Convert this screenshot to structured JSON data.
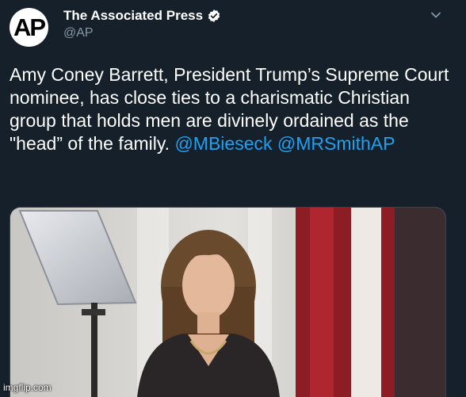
{
  "account": {
    "avatar_text": "AP",
    "display_name": "The Associated Press",
    "handle": "@AP",
    "verified_icon": "verified-badge-icon",
    "menu_icon": "chevron-down-icon"
  },
  "tweet": {
    "text": "Amy Coney Barrett, President Trump’s Supreme Court nominee, has close ties to a charismatic Christian group that holds men are divinely ordained as the \"head” of the family.",
    "mentions": [
      "@MBieseck",
      "@MRSmithAP"
    ]
  },
  "media": {
    "description": "photo"
  },
  "watermark": "imgflip.com",
  "colors": {
    "background": "#15202b",
    "text": "#ffffff",
    "secondary_text": "#8899a6",
    "link": "#1da1f2",
    "verified": "#1da1f2"
  }
}
